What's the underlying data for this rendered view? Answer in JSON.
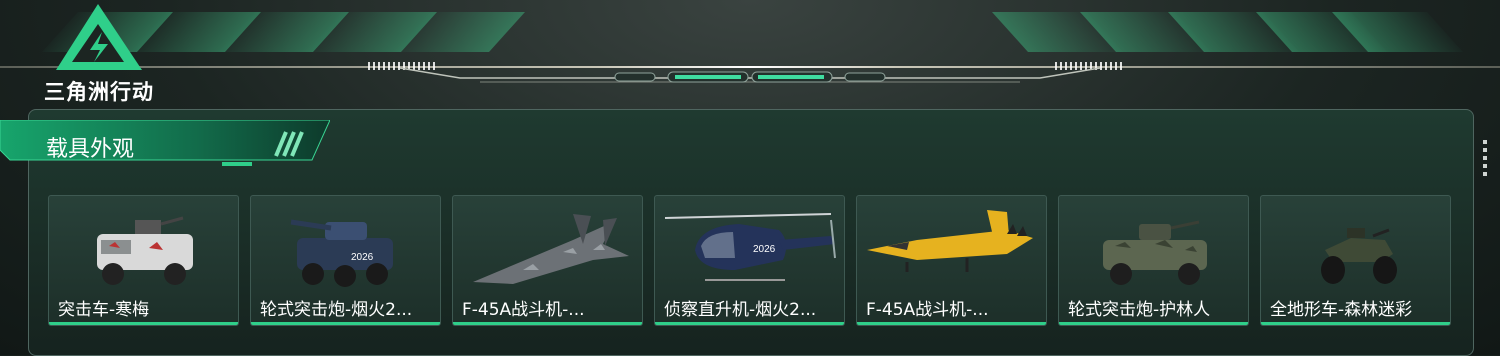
{
  "game": {
    "logo_text": "三角洲行动"
  },
  "section": {
    "title": "载具外观"
  },
  "colors": {
    "accent": "#2fcf8a",
    "panel": "#1f3a30"
  },
  "vehicles": [
    {
      "name": "突击车-寒梅",
      "icon": "armored-car-icon"
    },
    {
      "name": "轮式突击炮-烟火2...",
      "icon": "wheeled-assault-gun-icon"
    },
    {
      "name": "F-45A战斗机-...",
      "icon": "fighter-jet-icon"
    },
    {
      "name": "侦察直升机-烟火2...",
      "icon": "helicopter-icon"
    },
    {
      "name": "F-45A战斗机-...",
      "icon": "fighter-jet-icon"
    },
    {
      "name": "轮式突击炮-护林人",
      "icon": "wheeled-assault-gun-icon"
    },
    {
      "name": "全地形车-森林迷彩",
      "icon": "atv-icon"
    }
  ]
}
